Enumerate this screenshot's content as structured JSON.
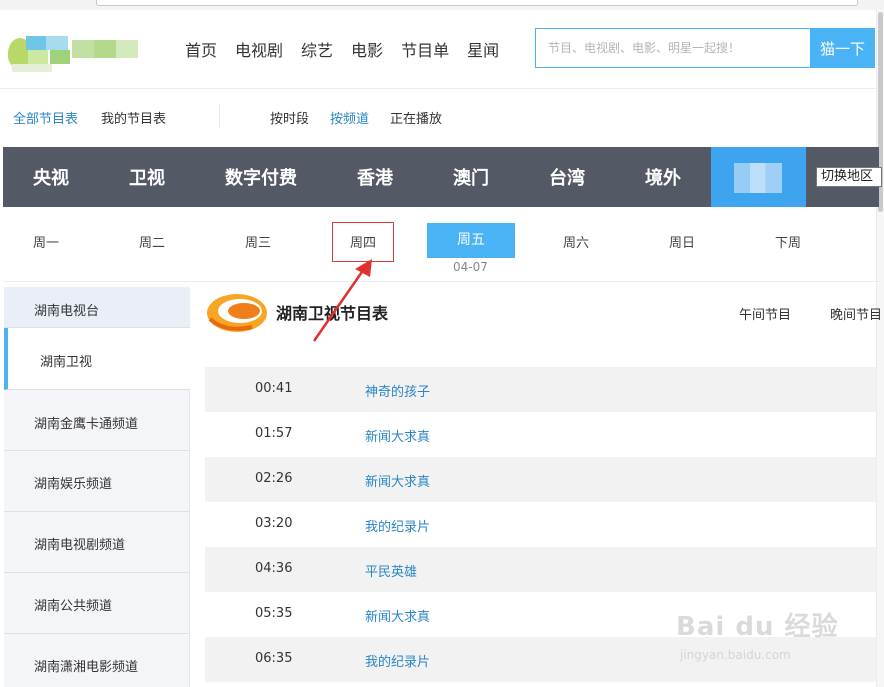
{
  "header": {
    "nav": [
      "首页",
      "电视剧",
      "综艺",
      "电影",
      "节目单",
      "星闻"
    ],
    "search_placeholder": "节目、电视剧、电影、明星一起搜！",
    "search_button": "猫一下"
  },
  "subnav": {
    "all_schedules": "全部节目表",
    "my_schedule": "我的节目表",
    "by_time": "按时段",
    "by_channel": "按频道",
    "now_playing": "正在播放"
  },
  "regions": [
    "央视",
    "卫视",
    "数字付费",
    "香港",
    "澳门",
    "台湾",
    "境外"
  ],
  "switch_region": "切换地区",
  "days": [
    "周一",
    "周二",
    "周三",
    "周四",
    "周五",
    "周六",
    "周日",
    "下周"
  ],
  "selected_day_date": "04-07",
  "sidebar": {
    "group": "湖南电视台",
    "active": "湖南卫视",
    "channels": [
      "湖南金鹰卡通频道",
      "湖南娱乐频道",
      "湖南电视剧频道",
      "湖南公共频道",
      "湖南潇湘电影频道"
    ]
  },
  "channel": {
    "title": "湖南卫视节目表",
    "tab_noon": "午间节目",
    "tab_evening": "晚间节目"
  },
  "schedule": [
    {
      "time": "00:41",
      "program": "神奇的孩子"
    },
    {
      "time": "01:57",
      "program": "新闻大求真"
    },
    {
      "time": "02:26",
      "program": "新闻大求真"
    },
    {
      "time": "03:20",
      "program": "我的纪录片"
    },
    {
      "time": "04:36",
      "program": "平民英雄"
    },
    {
      "time": "05:35",
      "program": "新闻大求真"
    },
    {
      "time": "06:35",
      "program": "我的纪录片"
    }
  ],
  "watermark": {
    "text": "Bai du 经验",
    "sub": "jingyan.baidu.com"
  },
  "colors": {
    "accent": "#4ab3f5",
    "region_bar": "#535a66",
    "link": "#2b86c5",
    "annotation": "#d93b3b"
  }
}
